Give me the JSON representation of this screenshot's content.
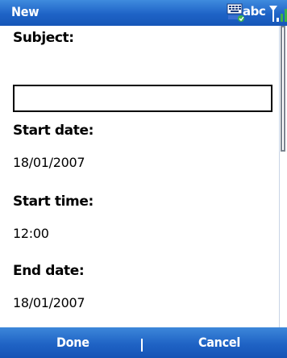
{
  "titlebar": {
    "title": "New",
    "input_mode": "abc",
    "keyboard_icon": "keyboard-icon",
    "signal_icon": "signal-strength-icon"
  },
  "form": {
    "subject_label": "Subject:",
    "subject_value": "",
    "start_date_label": "Start date:",
    "start_date_value": "18/01/2007",
    "start_time_label": "Start time:",
    "start_time_value": "12:00",
    "end_date_label": "End date:",
    "end_date_value": "18/01/2007"
  },
  "softkeys": {
    "left": "Done",
    "right": "Cancel"
  },
  "colors": {
    "bar_blue": "#1e63c6",
    "text": "#000000",
    "bar_text": "#ffffff"
  }
}
